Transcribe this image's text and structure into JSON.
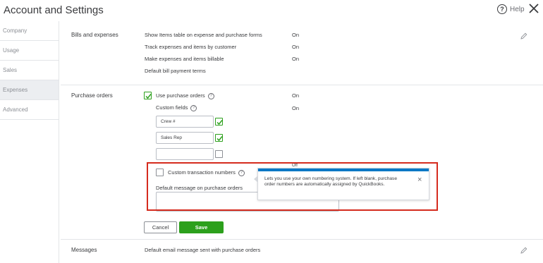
{
  "header": {
    "title": "Account and Settings",
    "help_label": "Help",
    "help_icon_glyph": "?"
  },
  "sidebar": {
    "items": [
      {
        "label": "Company"
      },
      {
        "label": "Usage"
      },
      {
        "label": "Sales"
      },
      {
        "label": "Expenses"
      },
      {
        "label": "Advanced"
      }
    ],
    "active": "Expenses"
  },
  "bills_and_expenses": {
    "label": "Bills and expenses",
    "rows": [
      {
        "text": "Show Items table on expense and purchase forms",
        "value": "On"
      },
      {
        "text": "Track expenses and items by customer",
        "value": "On"
      },
      {
        "text": "Make expenses and items billable",
        "value": "On"
      },
      {
        "text": "Default bill payment terms",
        "value": ""
      }
    ]
  },
  "purchase_orders": {
    "label": "Purchase orders",
    "use_po_label": "Use purchase orders",
    "use_po_value": "On",
    "custom_fields_label": "Custom fields",
    "custom_fields_value": "On",
    "fields": [
      {
        "value": "Crew #",
        "checked": true
      },
      {
        "value": "Sales Rep",
        "checked": true
      },
      {
        "value": "",
        "checked": false
      }
    ],
    "custom_txn_label": "Custom transaction numbers",
    "custom_txn_value": "Off",
    "default_message_label": "Default message on purchase orders",
    "cancel_label": "Cancel",
    "save_label": "Save"
  },
  "tooltip": {
    "text": "Lets you use your own numbering system. If left blank, purchase order numbers are automatically assigned by QuickBooks.",
    "close_glyph": "×"
  },
  "messages": {
    "label": "Messages",
    "row_text": "Default email message sent with purchase orders"
  },
  "colors": {
    "accent_green": "#2ca01c",
    "accent_blue": "#0077c5",
    "highlight_red": "#d52b1e"
  }
}
